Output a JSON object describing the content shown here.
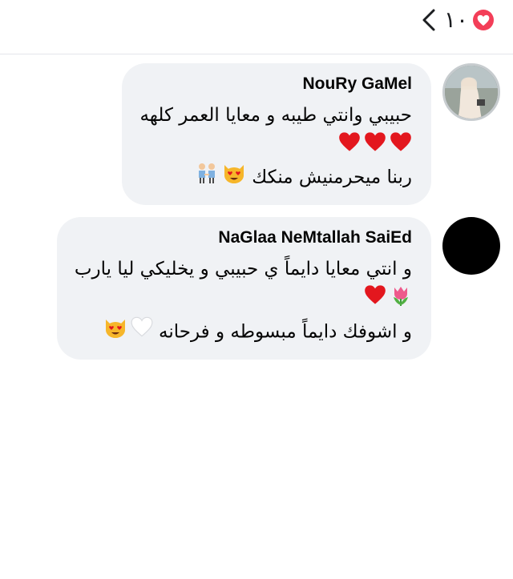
{
  "reactions": {
    "count": "١٠",
    "badge_icon": "heart-icon",
    "badge_color": "#f33e58",
    "back_icon": "chevron-left-icon"
  },
  "comments": [
    {
      "author": "NouRy GaMel",
      "avatar": "profile-photo",
      "lines": [
        "حبيبي وانتي طيبه و معايا العمر كلهه",
        "",
        "ربنا ميحرمنيش منكك"
      ],
      "emojis": [
        "red-heart",
        "red-heart",
        "red-heart",
        "heart-eyes-cat",
        "women-holding-hands"
      ]
    },
    {
      "author": "NaGlaa NeMtallah SaiEd",
      "avatar": "black-circle",
      "lines": [
        "و انتي معايا دايماً ي حبيبي و يخليكي ليا يارب",
        "",
        "و اشوفك دايماً مبسوطه و فرحانه"
      ],
      "emojis": [
        "tulip",
        "red-heart",
        "white-heart",
        "heart-eyes-cat"
      ]
    }
  ]
}
